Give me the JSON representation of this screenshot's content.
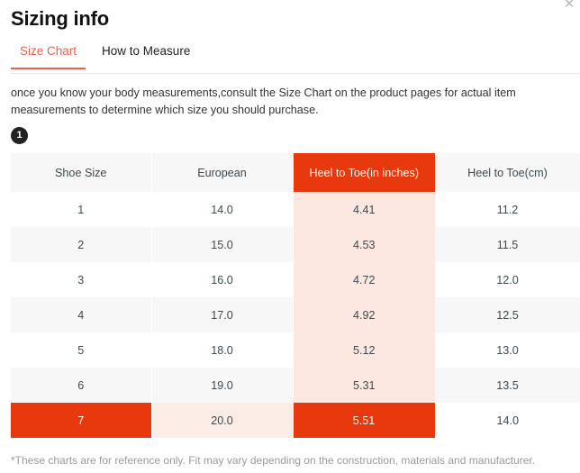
{
  "window": {
    "title": "Sizing info",
    "close_label": "✕"
  },
  "tabs": [
    {
      "label": "Size Chart",
      "active": true
    },
    {
      "label": "How to Measure",
      "active": false
    }
  ],
  "description": "once you know your body measurements,consult the Size Chart on the product pages for actual item measurements to determine which size you should purchase.",
  "step_badge": "1",
  "footer_note": "*These charts are for reference only. Fit may vary depending on the construction, materials and manufacturer.",
  "colors": {
    "accent_red": "#e8380d",
    "tab_active": "#e8604f",
    "highlight_column": "#fce8e1",
    "row_stripe": "#f7f7f7",
    "badge": "#222222"
  },
  "table": {
    "headers": [
      "Shoe Size",
      "European",
      "Heel to Toe(in inches)",
      "Heel to Toe(cm)"
    ],
    "highlighted_column_index": 2,
    "selected_row_index": 6,
    "rows": [
      {
        "shoe_size": "1",
        "european": "14.0",
        "heel_to_toe_in": "4.41",
        "heel_to_toe_cm": "11.2"
      },
      {
        "shoe_size": "2",
        "european": "15.0",
        "heel_to_toe_in": "4.53",
        "heel_to_toe_cm": "11.5"
      },
      {
        "shoe_size": "3",
        "european": "16.0",
        "heel_to_toe_in": "4.72",
        "heel_to_toe_cm": "12.0"
      },
      {
        "shoe_size": "4",
        "european": "17.0",
        "heel_to_toe_in": "4.92",
        "heel_to_toe_cm": "12.5"
      },
      {
        "shoe_size": "5",
        "european": "18.0",
        "heel_to_toe_in": "5.12",
        "heel_to_toe_cm": "13.0"
      },
      {
        "shoe_size": "6",
        "european": "19.0",
        "heel_to_toe_in": "5.31",
        "heel_to_toe_cm": "13.5"
      },
      {
        "shoe_size": "7",
        "european": "20.0",
        "heel_to_toe_in": "5.51",
        "heel_to_toe_cm": "14.0"
      }
    ]
  }
}
